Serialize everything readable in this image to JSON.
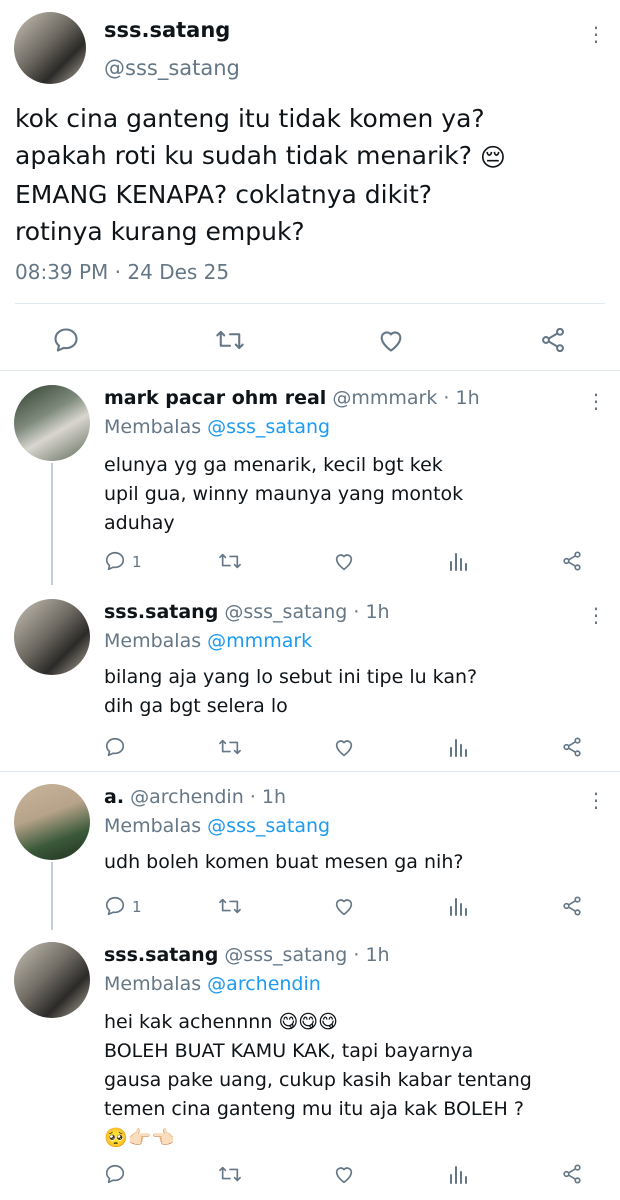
{
  "main_tweet": {
    "name": "sss.satang",
    "handle": "@sss_satang",
    "text_lines": [
      "kok cina ganteng itu tidak komen ya?",
      "apakah roti ku sudah tidak menarik?",
      "EMANG KENAPA? coklatnya dikit?",
      "rotinya kurang empuk?"
    ],
    "emoji": "😔",
    "time": "08:39 PM",
    "date": "24 Des 25",
    "icons": [
      "reply-icon",
      "retweet-icon",
      "like-icon",
      "share-icon"
    ]
  },
  "replies": [
    {
      "name": "mark pacar ohm real",
      "handle": "@mmmark",
      "age": "1h",
      "replying_label": "Membalas",
      "replying_to": "@sss_satang",
      "text_lines": [
        "elunya yg ga menarik, kecil bgt kek",
        "upil gua, winny maunya yang montok",
        "aduhay"
      ],
      "reply_count": "1"
    },
    {
      "name": "sss.satang",
      "handle": "@sss_satang",
      "age": "1h",
      "replying_label": "Membalas",
      "replying_to": "@mmmark",
      "text_lines": [
        "bilang aja yang lo sebut ini tipe lu kan?",
        "dih ga bgt selera lo"
      ],
      "reply_count": ""
    },
    {
      "name": "a.",
      "handle": "@archendin",
      "age": "1h",
      "replying_label": "Membalas",
      "replying_to": "@sss_satang",
      "text_lines": [
        "udh boleh komen buat mesen ga nih?"
      ],
      "reply_count": "1"
    },
    {
      "name": "sss.satang",
      "handle": "@sss_satang",
      "age": "1h",
      "replying_label": "Membalas",
      "replying_to": "@archendin",
      "text_lines": [
        "hei kak achennnn",
        "BOLEH BUAT KAMU KAK, tapi bayarnya",
        "gausa pake uang, cukup kasih kabar tentang",
        "temen cina ganteng mu itu aja kak BOLEH ?"
      ],
      "emoji_line_1": "😋😋😋",
      "emoji_line_5": "🥺👉🏻👈🏻",
      "reply_count": ""
    }
  ],
  "colors": {
    "text": "#0f1419",
    "secondary": "#657786",
    "link": "#1d9bf0",
    "divider": "#e1e8ed"
  }
}
